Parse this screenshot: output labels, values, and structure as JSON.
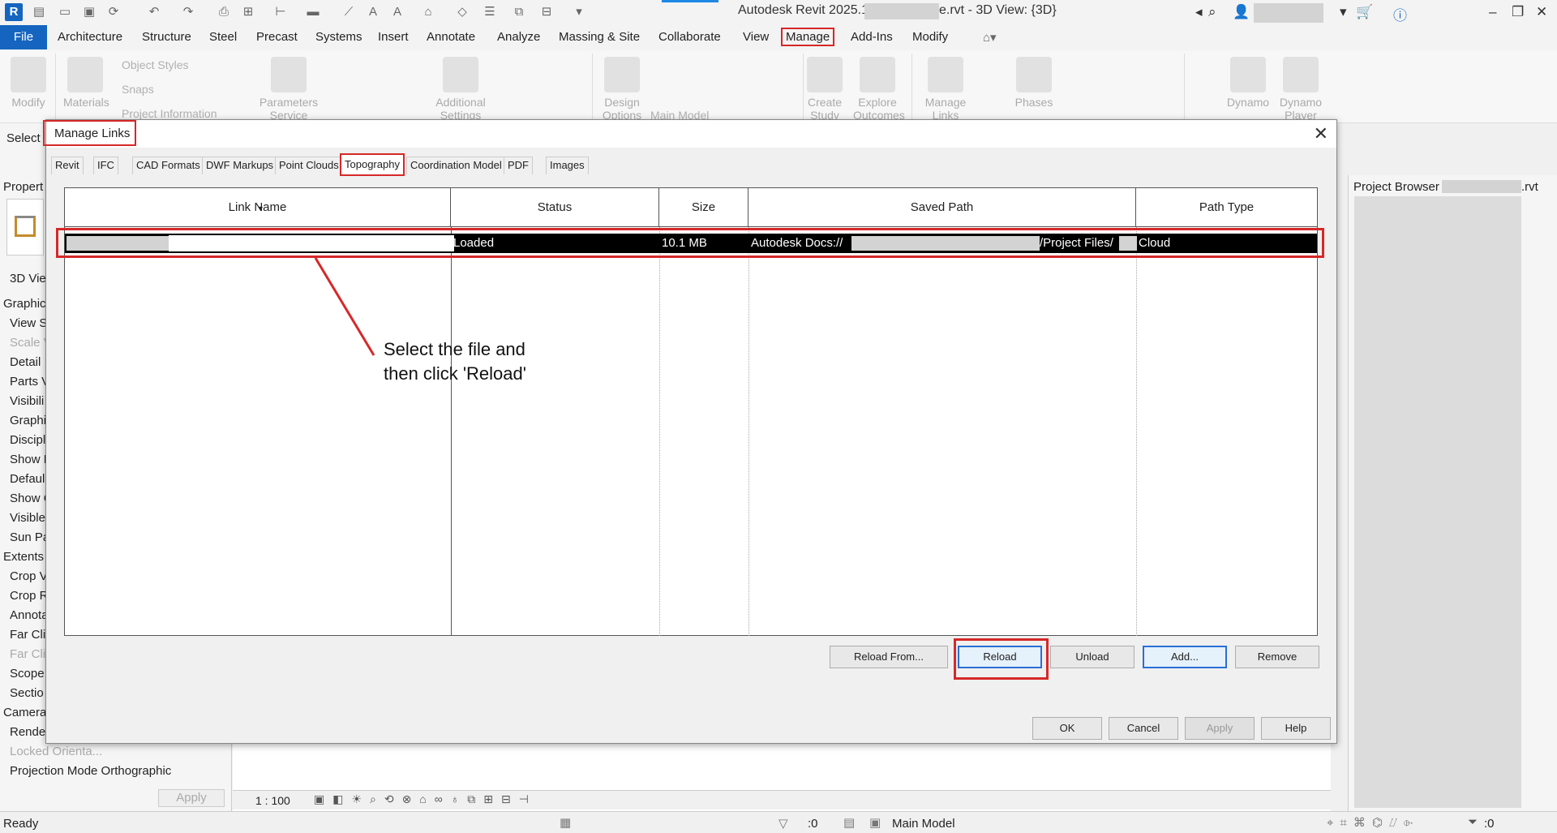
{
  "window": {
    "title_prefix": "Autodesk Revit 2025.1 -",
    "title_suffix": "e.rvt - 3D View: {3D}",
    "logo": "R"
  },
  "menu": {
    "file": "File",
    "items": [
      "Architecture",
      "Structure",
      "Steel",
      "Precast",
      "Systems",
      "Insert",
      "Annotate",
      "Analyze",
      "Massing & Site",
      "Collaborate",
      "View",
      "Manage",
      "Add-Ins",
      "Modify"
    ],
    "active": "Manage"
  },
  "ribbon": {
    "modify": "Modify",
    "materials": "Materials",
    "object_styles": "Object Styles",
    "snaps": "Snaps",
    "project_information": "Project Information",
    "parameters_service": "Parameters Service",
    "additional_settings": "Additional Settings",
    "design_options": "Design Options",
    "main_model": "Main Model",
    "create_study": "Create Study",
    "explore_outcomes": "Explore Outcomes",
    "manage_links": "Manage Links",
    "phases": "Phases",
    "dynamo": "Dynamo",
    "dynamo_player": "Dynamo Player"
  },
  "left_panel": {
    "select": "Select",
    "properties": "Propert",
    "type_label": "3D View",
    "rows": [
      {
        "text": "Graphic",
        "kind": "cat"
      },
      {
        "text": "View S",
        "kind": "normal"
      },
      {
        "text": "Scale V",
        "kind": "dim"
      },
      {
        "text": "Detail",
        "kind": "normal"
      },
      {
        "text": "Parts V",
        "kind": "normal"
      },
      {
        "text": "Visibili",
        "kind": "normal"
      },
      {
        "text": "Graphi",
        "kind": "normal"
      },
      {
        "text": "Discipl",
        "kind": "normal"
      },
      {
        "text": "Show H",
        "kind": "normal"
      },
      {
        "text": "Defaul",
        "kind": "normal"
      },
      {
        "text": "Show C",
        "kind": "normal"
      },
      {
        "text": "Visible",
        "kind": "normal"
      },
      {
        "text": "Sun Pa",
        "kind": "normal"
      },
      {
        "text": "Extents",
        "kind": "cat"
      },
      {
        "text": "Crop V",
        "kind": "normal"
      },
      {
        "text": "Crop R",
        "kind": "normal"
      },
      {
        "text": "Annota",
        "kind": "normal"
      },
      {
        "text": "Far Cli",
        "kind": "normal"
      },
      {
        "text": "Far Cli",
        "kind": "dim"
      },
      {
        "text": "Scope",
        "kind": "normal"
      },
      {
        "text": "Sectio",
        "kind": "normal"
      },
      {
        "text": "Camera",
        "kind": "cat"
      },
      {
        "text": "Rende",
        "kind": "normal"
      },
      {
        "text": "Locked Orienta...",
        "kind": "dim"
      },
      {
        "text": "Projection Mode Orthographic",
        "kind": "normal"
      }
    ],
    "apply": "Apply"
  },
  "view_bar": {
    "scale": "1 : 100"
  },
  "project_browser": {
    "title": "Project Browser",
    "suffix": ".rvt"
  },
  "status_bar": {
    "text": "Ready",
    "sel_count": ":0",
    "model": "Main Model",
    "filter_count": ":0"
  },
  "dialog": {
    "title": "Manage Links",
    "close": "✕",
    "tabs": [
      "Revit",
      "IFC",
      "CAD Formats",
      "DWF Markups",
      "Point Clouds",
      "Topography",
      "Coordination Model",
      "PDF",
      "Images"
    ],
    "active_tab": "Topography",
    "columns": [
      "Link Name",
      "Status",
      "Size",
      "Saved Path",
      "Path Type"
    ],
    "row": {
      "status": "Loaded",
      "size": "10.1 MB",
      "saved_path_prefix": "Autodesk Docs://",
      "saved_path_mid": "/Project Files/",
      "path_type": "Cloud"
    },
    "annotation": "Select the file and then click 'Reload'",
    "buttons": {
      "reload_from": "Reload From...",
      "reload": "Reload",
      "unload": "Unload",
      "add": "Add...",
      "remove": "Remove",
      "ok": "OK",
      "cancel": "Cancel",
      "apply": "Apply",
      "help": "Help"
    }
  },
  "colors": {
    "accent_blue": "#1565c0",
    "highlight_red": "#d62828",
    "selection_black": "#000000"
  }
}
